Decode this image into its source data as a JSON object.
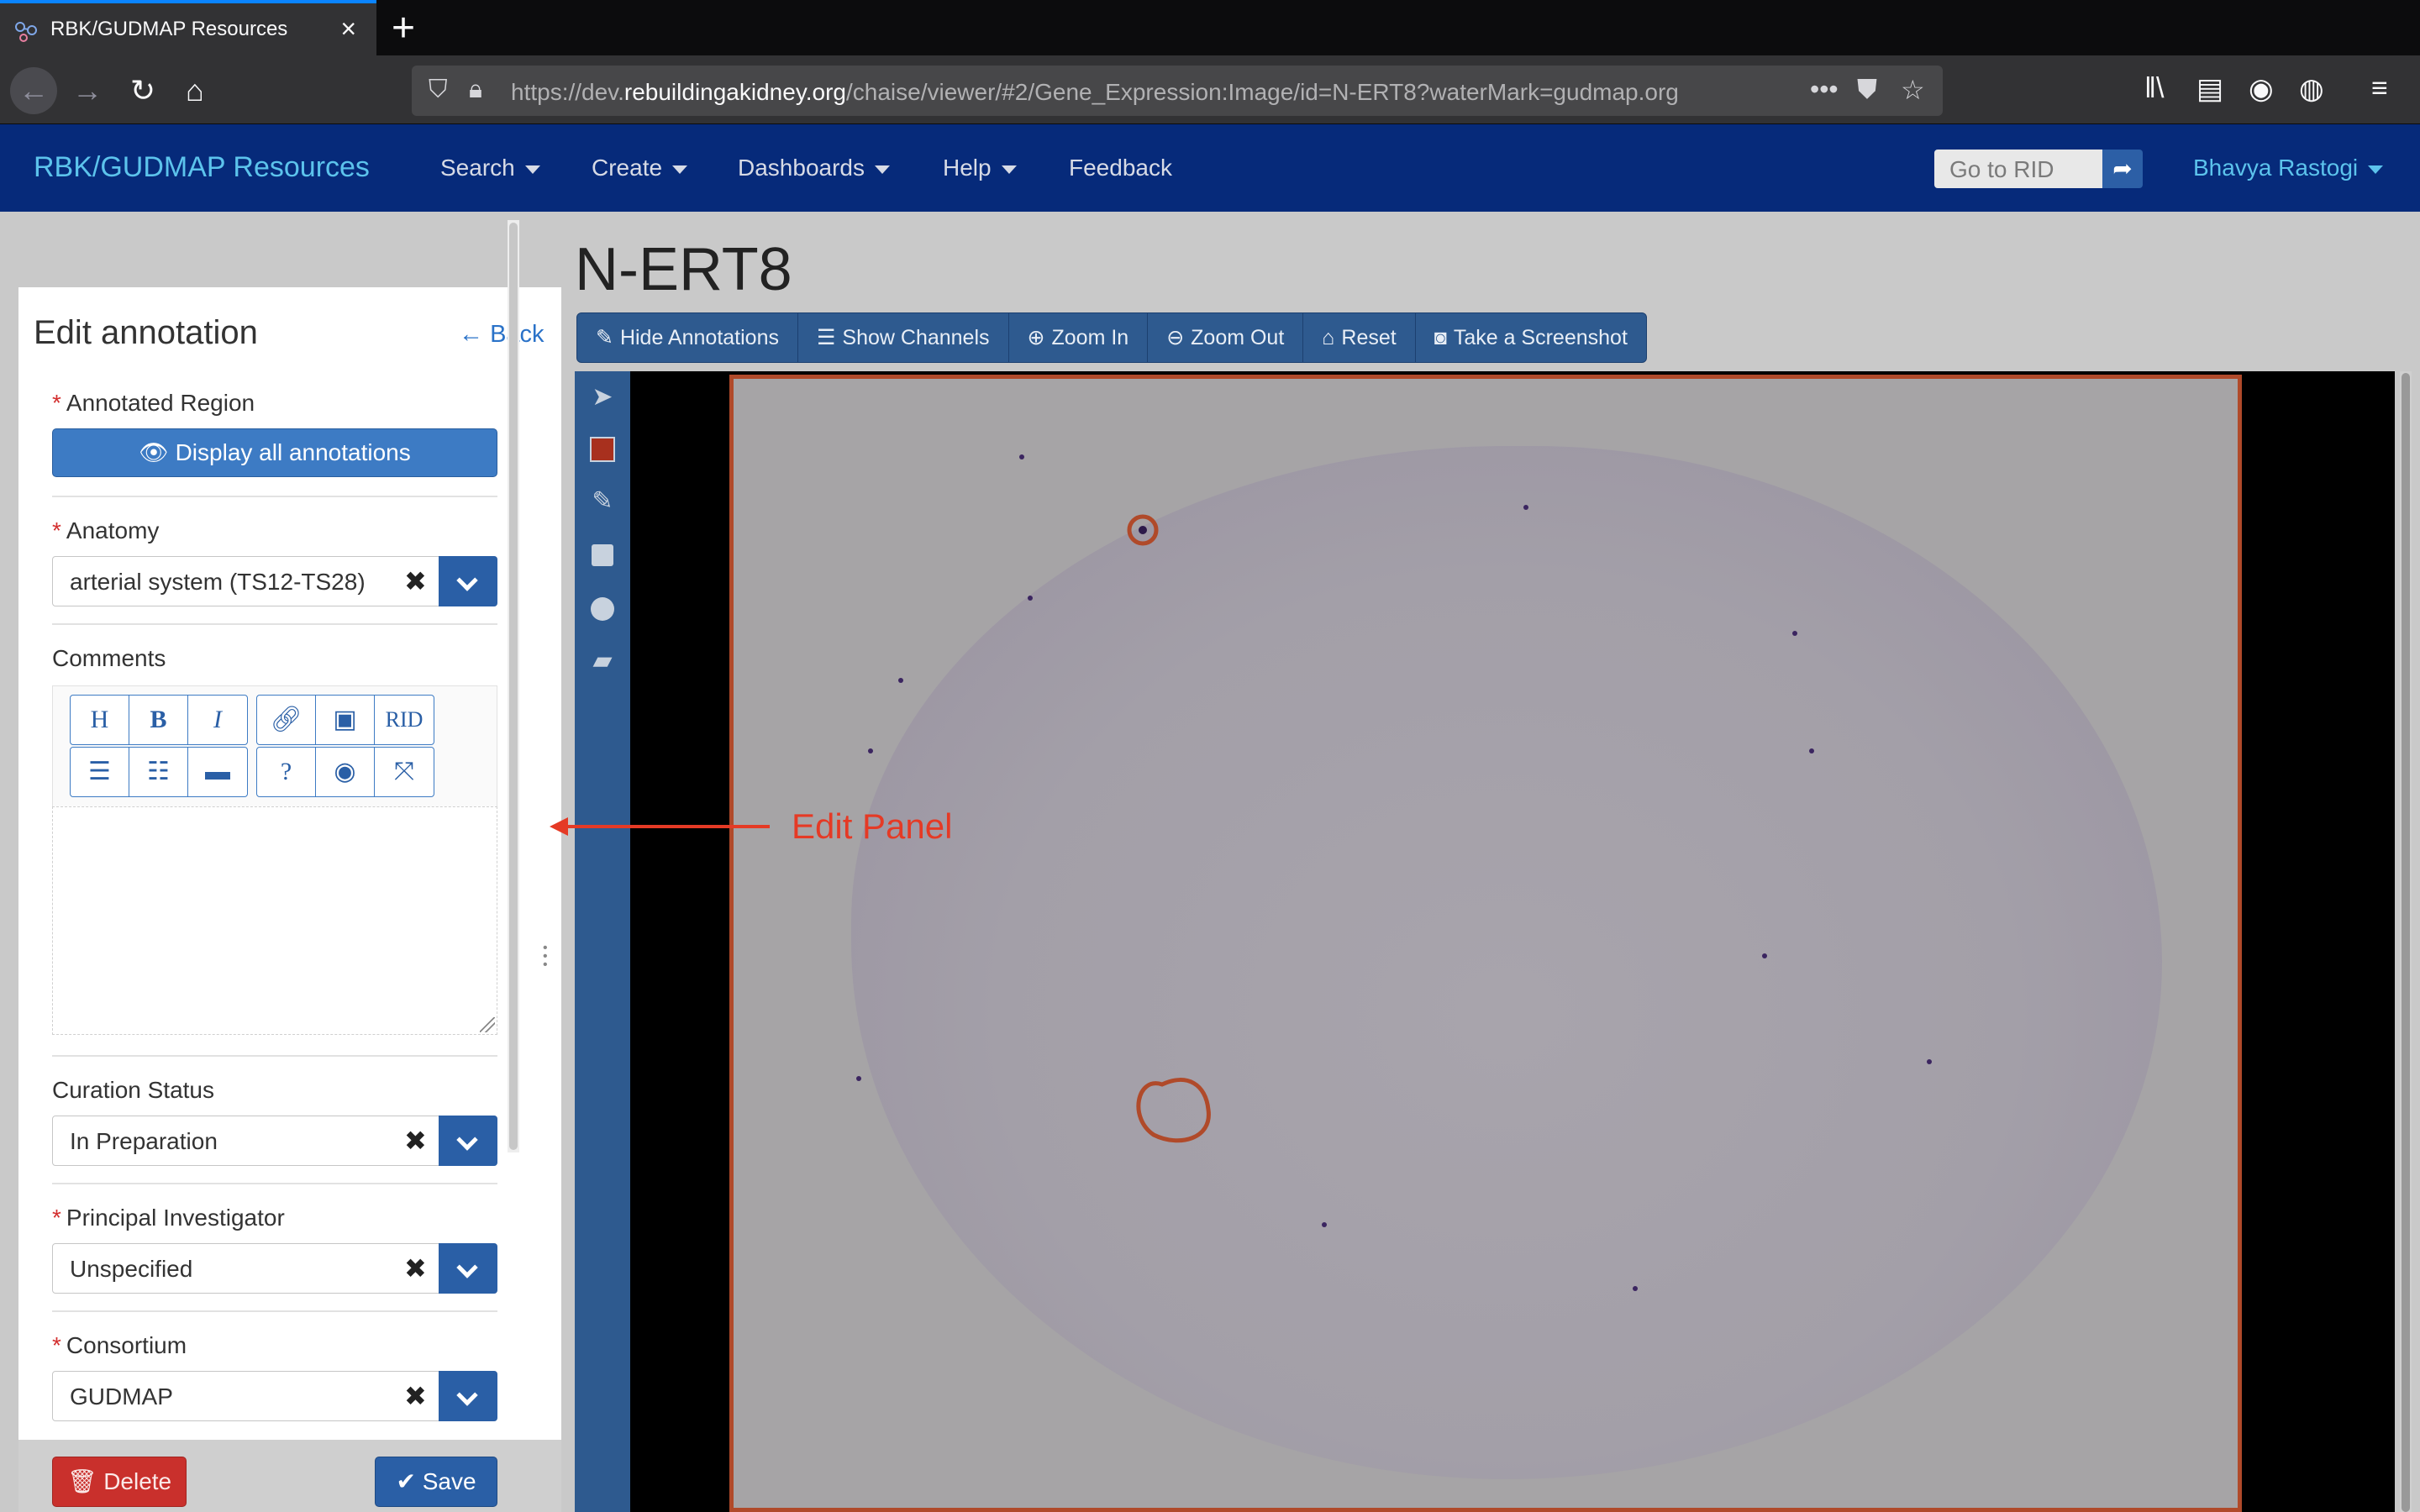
{
  "browser": {
    "tab_title": "RBK/GUDMAP Resources",
    "url_prefix": "https://dev.",
    "url_host": "rebuildingakidney.org",
    "url_path": "/chaise/viewer/#2/Gene_Expression:Image/id=N-ERT8?waterMark=gudmap.org"
  },
  "app": {
    "brand": "RBK/GUDMAP Resources",
    "menu": [
      "Search",
      "Create",
      "Dashboards",
      "Help",
      "Feedback"
    ],
    "go_to_rid_placeholder": "Go to RID",
    "user": "Bhavya Rastogi"
  },
  "page": {
    "title": "N-ERT8"
  },
  "viewer_toolbar": [
    {
      "icon": "edit-icon",
      "label": "Hide Annotations"
    },
    {
      "icon": "list-icon",
      "label": "Show Channels"
    },
    {
      "icon": "zoom-in-icon",
      "label": "Zoom In"
    },
    {
      "icon": "zoom-out-icon",
      "label": "Zoom Out"
    },
    {
      "icon": "home-icon",
      "label": "Reset"
    },
    {
      "icon": "camera-icon",
      "label": "Take a Screenshot"
    }
  ],
  "drawing_tools": [
    "cursor-icon",
    "color-swatch-icon",
    "pencil-icon",
    "square-icon",
    "circle-icon",
    "eraser-icon"
  ],
  "edit_panel": {
    "title": "Edit annotation",
    "back": "Back",
    "annotated_region_label": "Annotated Region",
    "display_all_button": "Display all annotations",
    "anatomy_label": "Anatomy",
    "anatomy_value": "arterial system (TS12-TS28)",
    "comments_label": "Comments",
    "md_buttons_row1": [
      "H",
      "B",
      "I",
      "link-icon",
      "image-icon",
      "RID"
    ],
    "md_buttons_row2": [
      "ordered-list-icon",
      "unordered-list-icon",
      "comment-icon",
      "help-icon",
      "preview-icon",
      "fullscreen-icon"
    ],
    "curation_label": "Curation Status",
    "curation_value": "In Preparation",
    "pi_label": "Principal Investigator",
    "pi_value": "Unspecified",
    "consortium_label": "Consortium",
    "consortium_value": "GUDMAP",
    "delete_button": "Delete",
    "save_button": "Save"
  },
  "callout": {
    "label": "Edit Panel",
    "color": "#e53a25"
  },
  "colors": {
    "app_bar": "#062a7a",
    "brand": "#5cc3ec",
    "primary": "#2a5fa6",
    "danger": "#c9302c",
    "annotation": "#b04a2a"
  }
}
